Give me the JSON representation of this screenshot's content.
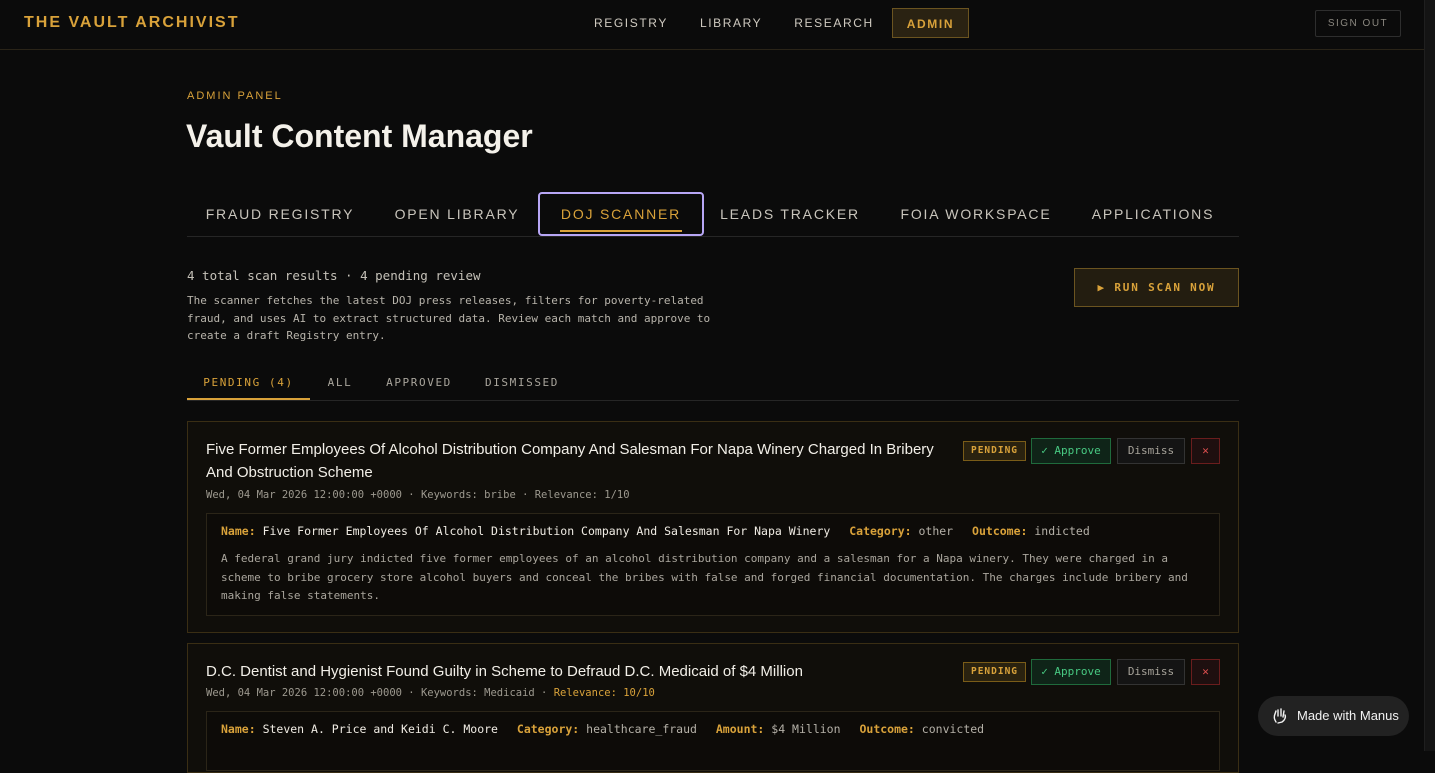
{
  "app": {
    "brand": "THE VAULT ARCHIVIST"
  },
  "nav": {
    "items": [
      {
        "label": "REGISTRY",
        "active": false
      },
      {
        "label": "LIBRARY",
        "active": false
      },
      {
        "label": "RESEARCH",
        "active": false
      },
      {
        "label": "ADMIN",
        "active": true
      }
    ],
    "sign_out": "SIGN OUT"
  },
  "header": {
    "eyebrow": "ADMIN PANEL",
    "title": "Vault Content Manager"
  },
  "tabs": [
    {
      "label": "FRAUD REGISTRY",
      "active": false
    },
    {
      "label": "OPEN LIBRARY",
      "active": false
    },
    {
      "label": "DOJ SCANNER",
      "active": true
    },
    {
      "label": "LEADS TRACKER",
      "active": false
    },
    {
      "label": "FOIA WORKSPACE",
      "active": false
    },
    {
      "label": "APPLICATIONS",
      "active": false
    }
  ],
  "scanner": {
    "summary": "4 total scan results · 4 pending review",
    "description": "The scanner fetches the latest DOJ press releases, filters for poverty-related fraud, and uses AI to extract structured data. Review each match and approve to create a draft Registry entry.",
    "run_button": "▶ RUN SCAN NOW"
  },
  "filters": [
    {
      "label": "PENDING (4)",
      "active": true
    },
    {
      "label": "ALL",
      "active": false
    },
    {
      "label": "APPROVED",
      "active": false
    },
    {
      "label": "DISMISSED",
      "active": false
    }
  ],
  "results": [
    {
      "title": "Five Former Employees Of Alcohol Distribution Company And Salesman For Napa Winery Charged In Bribery And Obstruction Scheme",
      "date": "Wed, 04 Mar 2026 12:00:00 +0000",
      "keywords": "Keywords: bribe",
      "relevance": "Relevance: 1/10",
      "status": "PENDING",
      "approve": "✓ Approve",
      "dismiss": "Dismiss",
      "remove": "✕",
      "name_label": "Name:",
      "name": "Five Former Employees Of Alcohol Distribution Company And Salesman For Napa Winery",
      "category_label": "Category:",
      "category": "other",
      "outcome_label": "Outcome:",
      "outcome": "indicted",
      "summary": "A federal grand jury indicted five former employees of an alcohol distribution company and a salesman for a Napa winery. They were charged in a scheme to bribe grocery store alcohol buyers and conceal the bribes with false and forged financial documentation. The charges include bribery and making false statements."
    },
    {
      "title": "D.C. Dentist and Hygienist Found Guilty in Scheme to Defraud D.C. Medicaid of $4 Million",
      "date": "Wed, 04 Mar 2026 12:00:00 +0000",
      "keywords": "Keywords: Medicaid",
      "relevance": "Relevance: 10/10",
      "status": "PENDING",
      "approve": "✓ Approve",
      "dismiss": "Dismiss",
      "remove": "✕",
      "name_label": "Name:",
      "name": "Steven A. Price and Keidi C. Moore",
      "category_label": "Category:",
      "category": "healthcare_fraud",
      "amount_label": "Amount:",
      "amount": "$4 Million",
      "outcome_label": "Outcome:",
      "outcome": "convicted"
    }
  ],
  "badge": {
    "label": "Made with Manus"
  },
  "colors": {
    "accent": "#d9a23a",
    "approve": "#48c982",
    "danger": "#e05050",
    "background": "#0b0b0b"
  }
}
